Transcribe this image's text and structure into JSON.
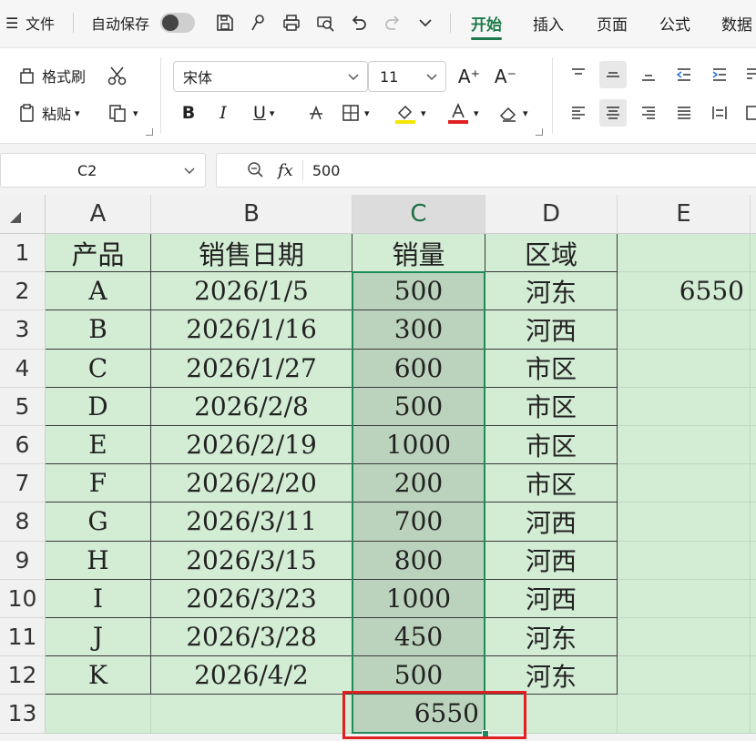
{
  "menubar": {
    "menu_icon": "☰",
    "file": "文件",
    "autosave": "自动保存",
    "tabs": [
      "开始",
      "插入",
      "页面",
      "公式",
      "数据"
    ],
    "active_tab": "开始"
  },
  "ribbon": {
    "format_painter": "格式刷",
    "paste": "粘贴",
    "font_name": "宋体",
    "font_size": "11",
    "bold": "B",
    "italic": "I",
    "underline": "U",
    "grow_font": "A⁺",
    "shrink_font": "A⁻",
    "highlight_color": "#f5e600",
    "font_color": "#e02020"
  },
  "formula_bar": {
    "name_box": "C2",
    "fx": "fx",
    "value": "500"
  },
  "sheet": {
    "columns": [
      "A",
      "B",
      "C",
      "D",
      "E"
    ],
    "row_numbers": [
      "1",
      "2",
      "3",
      "4",
      "5",
      "6",
      "7",
      "8",
      "9",
      "10",
      "11",
      "12",
      "13"
    ],
    "header": [
      "产品",
      "销售日期",
      "销量",
      "区域"
    ],
    "rows": [
      {
        "product": "A",
        "date": "2026/1/5",
        "qty": "500",
        "region": "河东"
      },
      {
        "product": "B",
        "date": "2026/1/16",
        "qty": "300",
        "region": "河西"
      },
      {
        "product": "C",
        "date": "2026/1/27",
        "qty": "600",
        "region": "市区"
      },
      {
        "product": "D",
        "date": "2026/2/8",
        "qty": "500",
        "region": "市区"
      },
      {
        "product": "E",
        "date": "2026/2/19",
        "qty": "1000",
        "region": "市区"
      },
      {
        "product": "F",
        "date": "2026/2/20",
        "qty": "200",
        "region": "市区"
      },
      {
        "product": "G",
        "date": "2026/3/11",
        "qty": "700",
        "region": "河西"
      },
      {
        "product": "H",
        "date": "2026/3/15",
        "qty": "800",
        "region": "河西"
      },
      {
        "product": "I",
        "date": "2026/3/23",
        "qty": "1000",
        "region": "河西"
      },
      {
        "product": "J",
        "date": "2026/3/28",
        "qty": "450",
        "region": "河东"
      },
      {
        "product": "K",
        "date": "2026/4/2",
        "qty": "500",
        "region": "河东"
      }
    ],
    "e2_value": "6550",
    "sum_value": "6550",
    "selected_column": "C",
    "highlight_color": "#e02020",
    "selection_color": "#1f8a5a"
  }
}
